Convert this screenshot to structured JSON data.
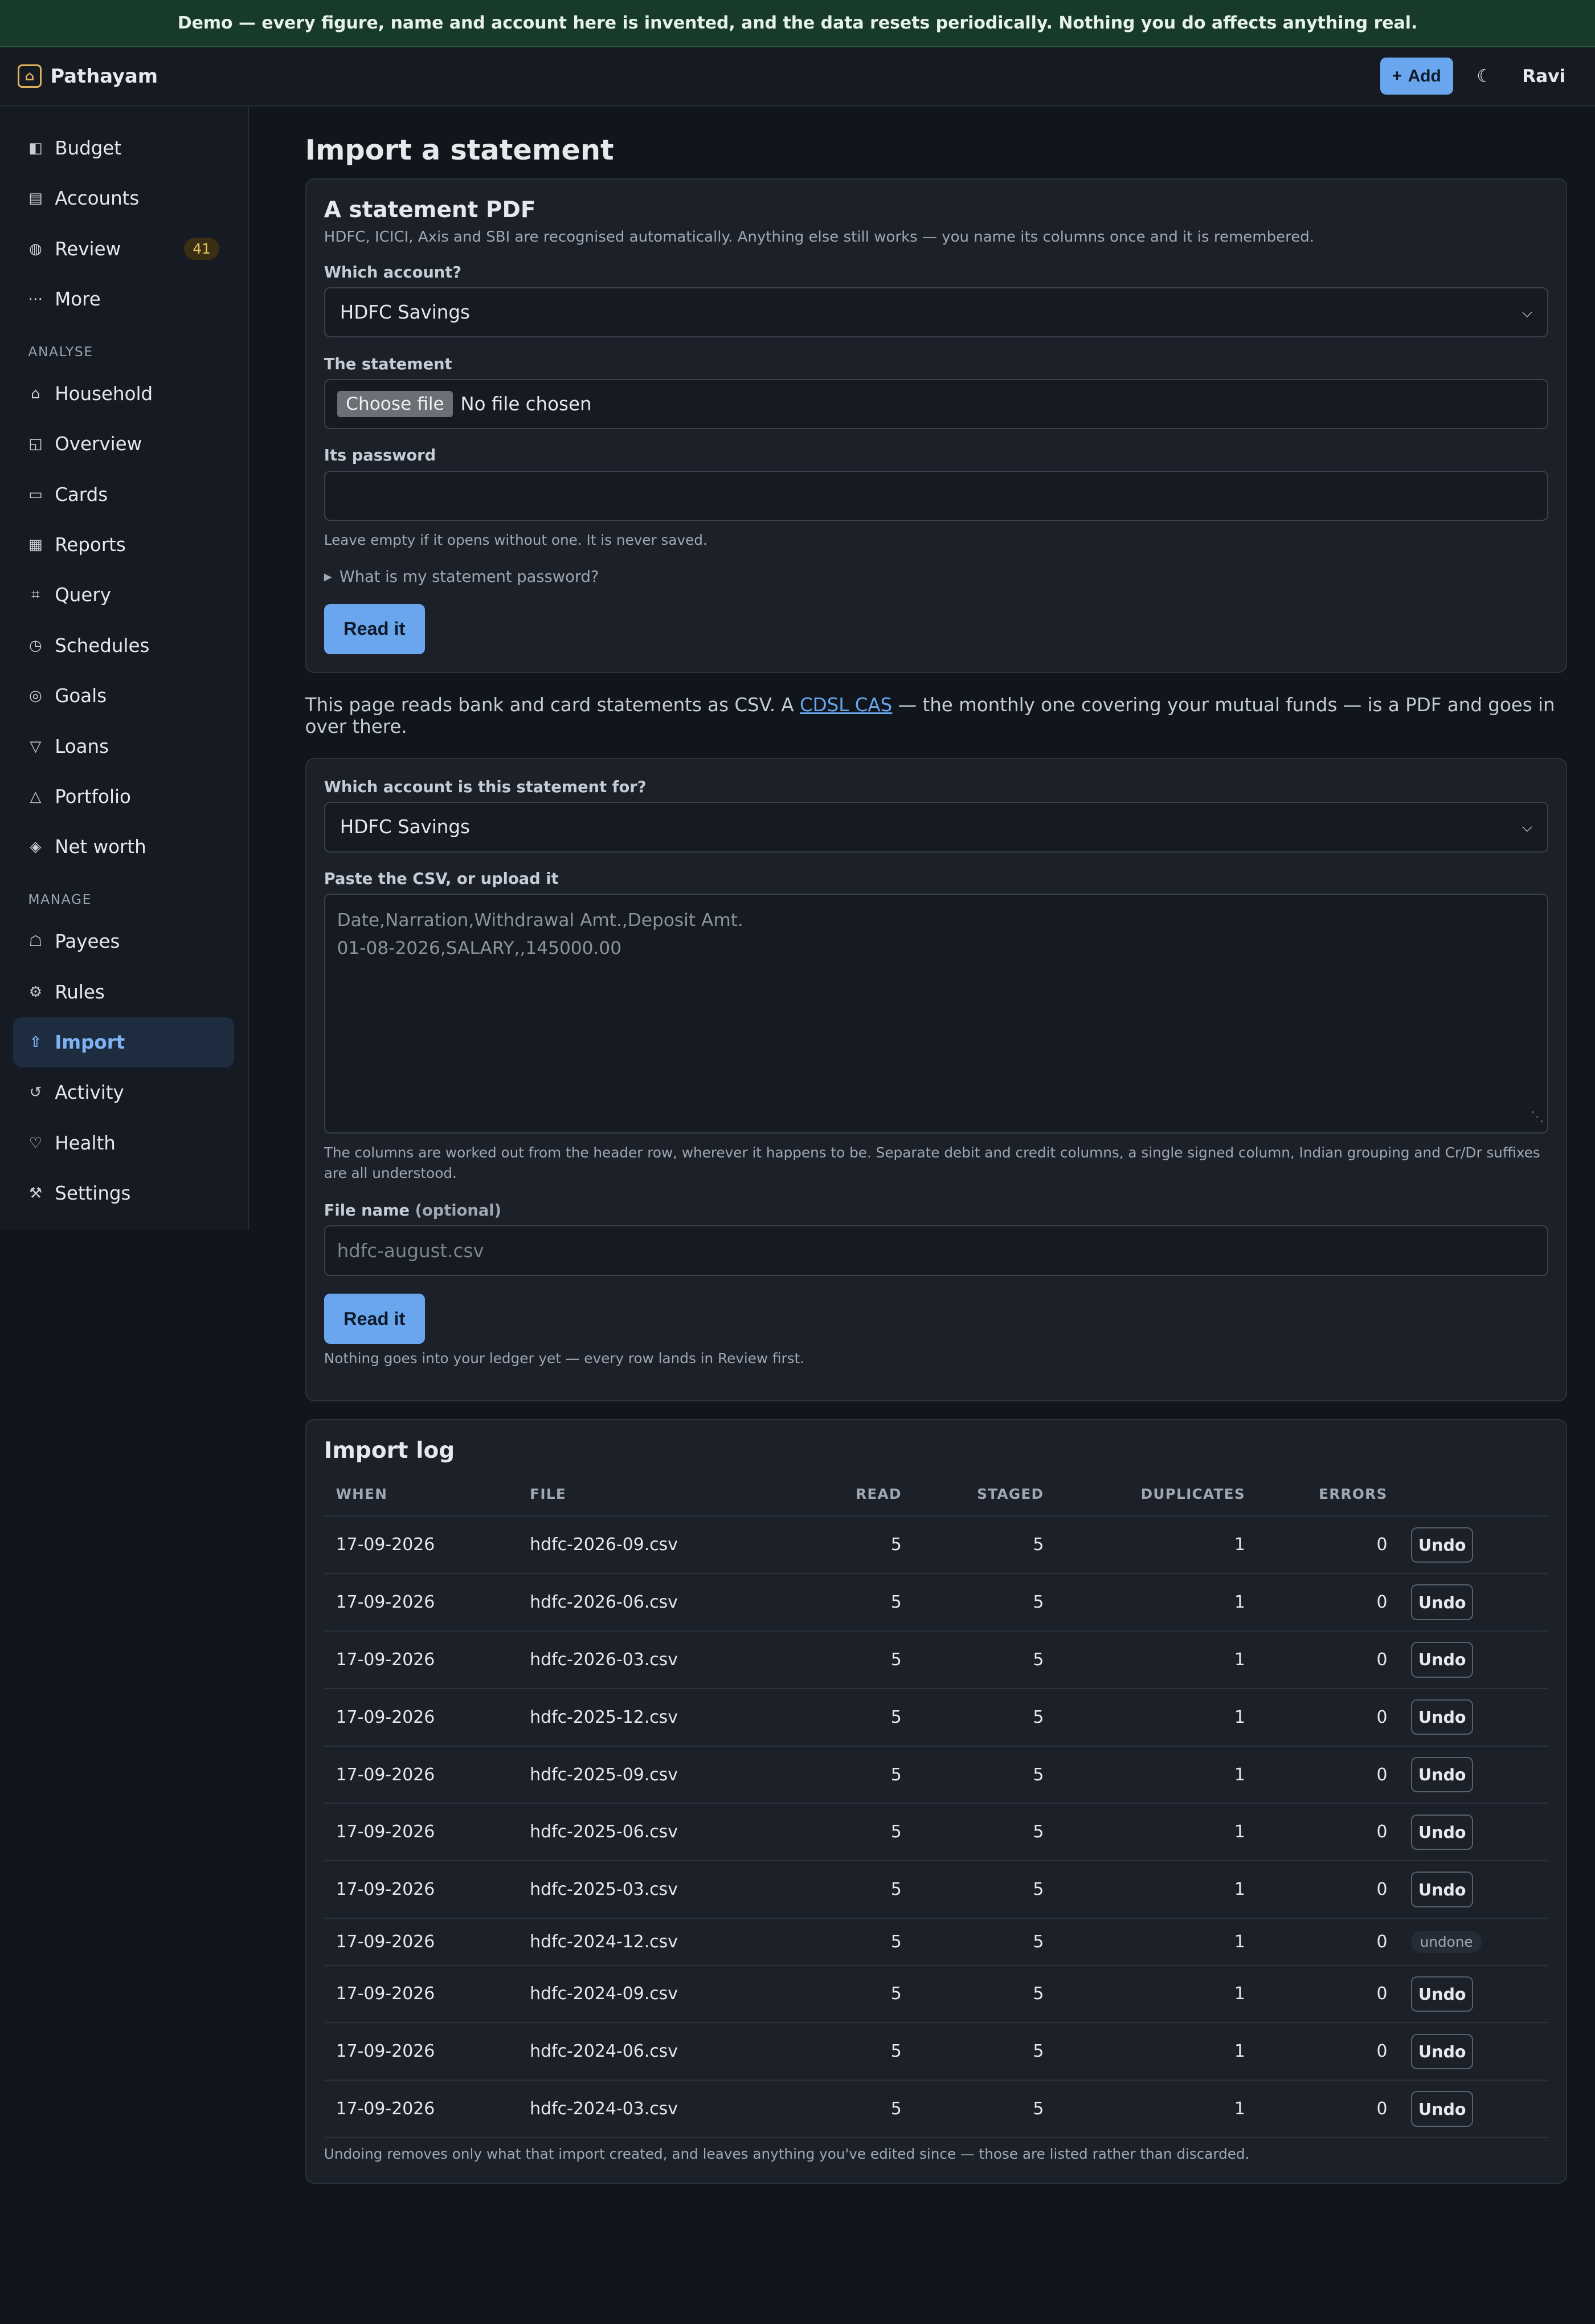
{
  "banner": {
    "text": "Demo — every figure, name and account here is invented, and the data resets periodically. Nothing you do affects anything real."
  },
  "header": {
    "app_name": "Pathayam",
    "add_label": "Add",
    "theme_glyph": "☾",
    "user": "Ravi",
    "logo_glyph": "⌂"
  },
  "sidebar": {
    "items_top": [
      {
        "icon": "◧",
        "label": "Budget"
      },
      {
        "icon": "▤",
        "label": "Accounts"
      },
      {
        "icon": "◍",
        "label": "Review",
        "badge": "41"
      },
      {
        "icon": "⋯",
        "label": "More"
      }
    ],
    "section_analyse": "ANALYSE",
    "items_analyse": [
      {
        "icon": "⌂",
        "label": "Household"
      },
      {
        "icon": "◱",
        "label": "Overview"
      },
      {
        "icon": "▭",
        "label": "Cards"
      },
      {
        "icon": "▦",
        "label": "Reports"
      },
      {
        "icon": "⌗",
        "label": "Query"
      },
      {
        "icon": "◷",
        "label": "Schedules"
      },
      {
        "icon": "◎",
        "label": "Goals"
      },
      {
        "icon": "▽",
        "label": "Loans"
      },
      {
        "icon": "△",
        "label": "Portfolio"
      },
      {
        "icon": "◈",
        "label": "Net worth"
      }
    ],
    "section_manage": "MANAGE",
    "items_manage": [
      {
        "icon": "☖",
        "label": "Payees"
      },
      {
        "icon": "⚙",
        "label": "Rules"
      },
      {
        "icon": "⇧",
        "label": "Import"
      },
      {
        "icon": "↺",
        "label": "Activity"
      },
      {
        "icon": "♡",
        "label": "Health"
      },
      {
        "icon": "⚒",
        "label": "Settings"
      }
    ]
  },
  "main": {
    "title": "Import a statement",
    "pdf": {
      "heading": "A statement PDF",
      "subtitle": "HDFC, ICICI, Axis and SBI are recognised automatically. Anything else still works — you name its columns once and it is remembered.",
      "account_label": "Which account?",
      "account_value": "HDFC Savings",
      "statement_label": "The statement",
      "choose_file": "Choose file",
      "no_file": "No file chosen",
      "password_label": "Its password",
      "password_hint": "Leave empty if it opens without one. It is never saved.",
      "details_summary": "What is my statement password?",
      "submit": "Read it"
    },
    "cas_note": {
      "before": "This page reads bank and card statements as CSV. A ",
      "link": "CDSL CAS",
      "after": " — the monthly one covering your mutual funds — is a PDF and goes in over there."
    },
    "csv": {
      "account_label": "Which account is this statement for?",
      "account_value": "HDFC Savings",
      "paste_label": "Paste the CSV, or upload it",
      "placeholder_line1": "Date,Narration,Withdrawal Amt.,Deposit Amt.",
      "placeholder_line2": "01-08-2026,SALARY,,145000.00",
      "columns_hint": "The columns are worked out from the header row, wherever it happens to be. Separate debit and credit columns, a single signed column, Indian grouping and Cr/Dr suffixes are all understood.",
      "filename_label": "File name",
      "filename_optional": "(optional)",
      "filename_placeholder": "hdfc-august.csv",
      "submit": "Read it",
      "footnote": "Nothing goes into your ledger yet — every row lands in Review first."
    },
    "log": {
      "heading": "Import log",
      "columns": [
        "WHEN",
        "FILE",
        "READ",
        "STAGED",
        "DUPLICATES",
        "ERRORS"
      ],
      "rows": [
        {
          "when": "17-09-2026",
          "file": "hdfc-2026-09.csv",
          "read": "5",
          "staged": "5",
          "duplicates": "1",
          "errors": "0",
          "action": "Undo"
        },
        {
          "when": "17-09-2026",
          "file": "hdfc-2026-06.csv",
          "read": "5",
          "staged": "5",
          "duplicates": "1",
          "errors": "0",
          "action": "Undo"
        },
        {
          "when": "17-09-2026",
          "file": "hdfc-2026-03.csv",
          "read": "5",
          "staged": "5",
          "duplicates": "1",
          "errors": "0",
          "action": "Undo"
        },
        {
          "when": "17-09-2026",
          "file": "hdfc-2025-12.csv",
          "read": "5",
          "staged": "5",
          "duplicates": "1",
          "errors": "0",
          "action": "Undo"
        },
        {
          "when": "17-09-2026",
          "file": "hdfc-2025-09.csv",
          "read": "5",
          "staged": "5",
          "duplicates": "1",
          "errors": "0",
          "action": "Undo"
        },
        {
          "when": "17-09-2026",
          "file": "hdfc-2025-06.csv",
          "read": "5",
          "staged": "5",
          "duplicates": "1",
          "errors": "0",
          "action": "Undo"
        },
        {
          "when": "17-09-2026",
          "file": "hdfc-2025-03.csv",
          "read": "5",
          "staged": "5",
          "duplicates": "1",
          "errors": "0",
          "action": "Undo"
        },
        {
          "when": "17-09-2026",
          "file": "hdfc-2024-12.csv",
          "read": "5",
          "staged": "5",
          "duplicates": "1",
          "errors": "0",
          "action": "undone"
        },
        {
          "when": "17-09-2026",
          "file": "hdfc-2024-09.csv",
          "read": "5",
          "staged": "5",
          "duplicates": "1",
          "errors": "0",
          "action": "Undo"
        },
        {
          "when": "17-09-2026",
          "file": "hdfc-2024-06.csv",
          "read": "5",
          "staged": "5",
          "duplicates": "1",
          "errors": "0",
          "action": "Undo"
        },
        {
          "when": "17-09-2026",
          "file": "hdfc-2024-03.csv",
          "read": "5",
          "staged": "5",
          "duplicates": "1",
          "errors": "0",
          "action": "Undo"
        }
      ],
      "footnote": "Undoing removes only what that import created, and leaves anything you've edited since — those are listed rather than discarded."
    }
  },
  "colors": {
    "accent": "#6aa6ee",
    "banner_bg": "#173a2a",
    "page_bg": "#11151c"
  },
  "active_nav": "Import"
}
